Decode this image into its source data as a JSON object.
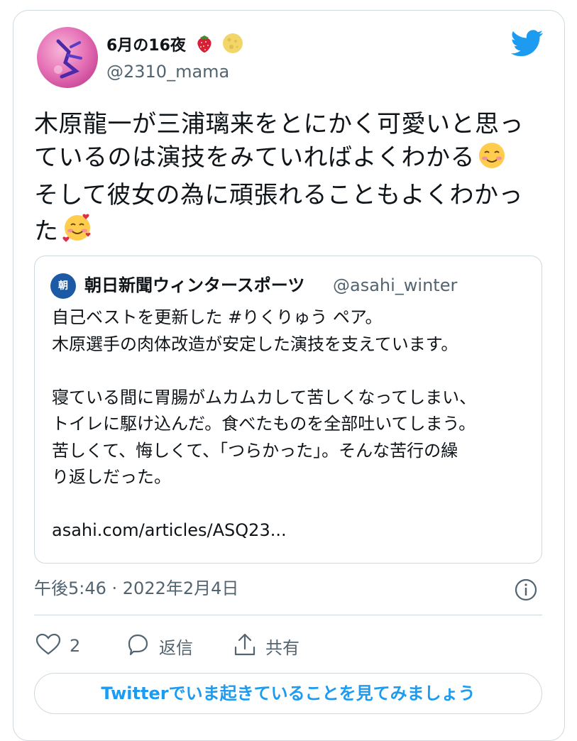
{
  "user": {
    "display_name": "6月の16夜",
    "name_emojis": [
      "strawberry-icon",
      "full-moon-icon"
    ],
    "handle": "@2310_mama"
  },
  "tweet": {
    "lines": [
      "木原龍一が三浦璃来をとにかく可愛いと思っ",
      "ているのは演技をみていればよくわかる",
      "そして彼女の為に頑張れることもよくわかっ",
      "た"
    ],
    "emojis": [
      "smiling-face-icon",
      "smiling-face-with-hearts-icon"
    ]
  },
  "quote": {
    "avatar_text": "朝",
    "name": "朝日新聞ウィンタースポーツ",
    "handle": "@asahi_winter",
    "lines": [
      "自己ベストを更新した #りくりゅう ペア。",
      "木原選手の肉体改造が安定した演技を支えています。",
      "",
      "寝ている間に胃腸がムカムカして苦しくなってしまい、",
      "トイレに駆け込んだ。食べたものを全部吐いてしまう。",
      "苦しくて、悔しくて、「つらかった」。そんな苦行の繰",
      "り返しだった。",
      "",
      "asahi.com/articles/ASQ23..."
    ]
  },
  "timestamp": "午後5:46 · 2022年2月4日",
  "actions": {
    "like_count": "2",
    "reply_label": "返信",
    "share_label": "共有"
  },
  "cta_label": "Twitterでいま起きていることを見てみましょう",
  "colors": {
    "accent": "#1d9bf0",
    "muted": "#536471",
    "border": "#cfd9de"
  }
}
